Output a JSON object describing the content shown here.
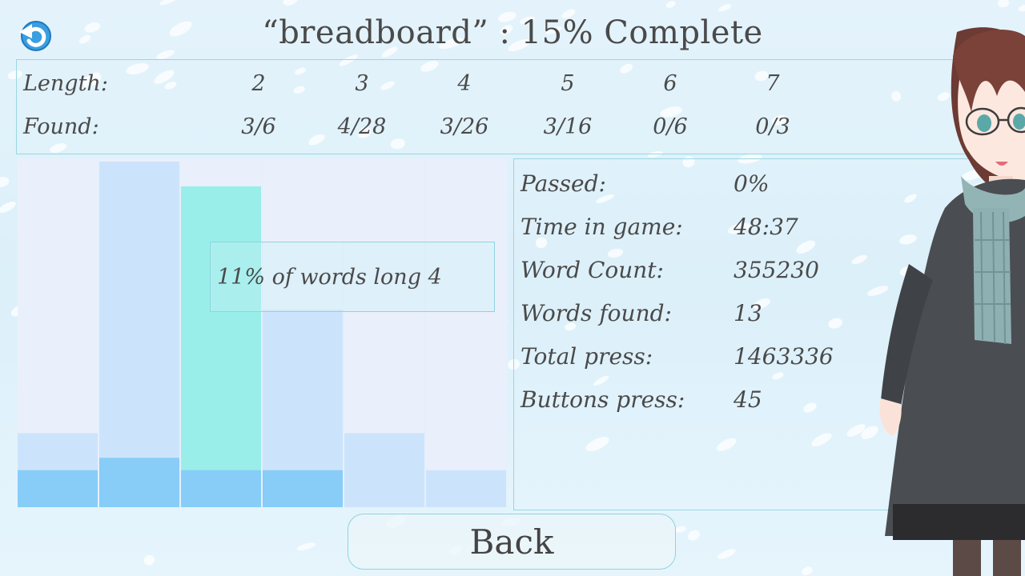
{
  "title": "“breadboard” : 15% Complete",
  "lengths": {
    "length_label": "Length:",
    "found_label": "Found:",
    "columns": [
      {
        "length": "2",
        "found": "3/6"
      },
      {
        "length": "3",
        "found": "4/28"
      },
      {
        "length": "4",
        "found": "3/26"
      },
      {
        "length": "5",
        "found": "3/16"
      },
      {
        "length": "6",
        "found": "0/6"
      },
      {
        "length": "7",
        "found": "0/3"
      }
    ]
  },
  "tooltip": "11% of words long 4",
  "stats": [
    {
      "label": "Passed:",
      "value": "0%"
    },
    {
      "label": "Time in game:",
      "value": "48:37"
    },
    {
      "label": "Word Count:",
      "value": "355230"
    },
    {
      "label": "Words found:",
      "value": "13"
    },
    {
      "label": "Total press:",
      "value": "1463336"
    },
    {
      "label": "Buttons press:",
      "value": "45"
    }
  ],
  "back_button": "Back",
  "icons": {
    "back_arrow": "undo-arrow-icon"
  },
  "colors": {
    "bar_total": "#cce4fb",
    "bar_found": "#87cdf8",
    "bar_selected": "#9aeeea",
    "panel_border": "#9ad6e2"
  },
  "chart_data": {
    "type": "bar",
    "categories": [
      "2",
      "3",
      "4",
      "5",
      "6",
      "7"
    ],
    "series": [
      {
        "values": [
          6,
          28,
          26,
          16,
          6,
          3
        ]
      },
      {
        "values": [
          3,
          4,
          3,
          3,
          0,
          0
        ]
      }
    ],
    "selected_category": "4",
    "ylim": [
      0,
      28
    ]
  }
}
